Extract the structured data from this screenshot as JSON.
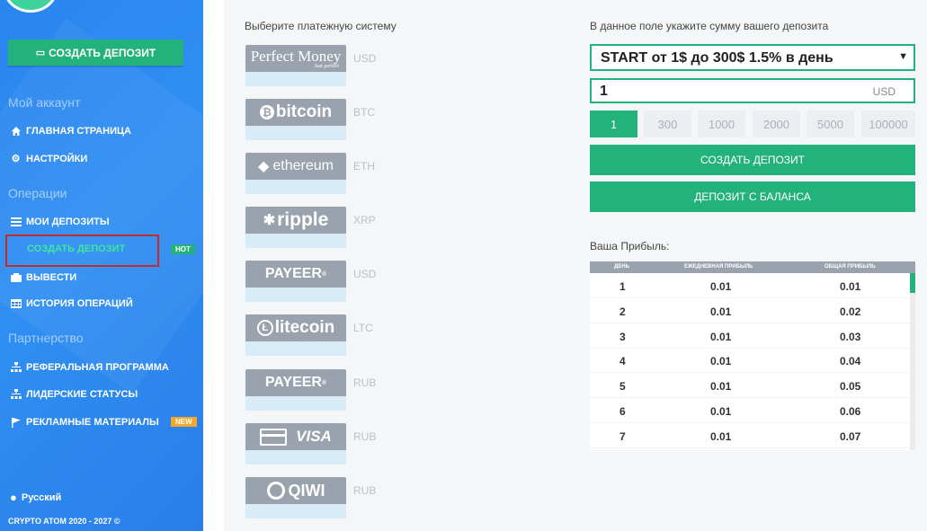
{
  "sidebar": {
    "create_button": "СОЗДАТЬ ДЕПОЗИТ",
    "sections": {
      "account": "Мой аккаунт",
      "operations": "Операции",
      "partnership": "Партнерство"
    },
    "items": {
      "home": "ГЛАВНАЯ СТРАНИЦА",
      "settings": "НАСТРОЙКИ",
      "my_deposits": "МОИ ДЕПОЗИТЫ",
      "create_deposit": "СОЗДАТЬ ДЕПОЗИТ",
      "withdraw": "ВЫВЕСТИ",
      "history": "ИСТОРИЯ ОПЕРАЦИЙ",
      "referral": "РЕФЕРАЛЬНАЯ ПРОГРАММА",
      "leader": "ЛИДЕРСКИЕ СТАТУСЫ",
      "promo": "РЕКЛАМНЫЕ МАТЕРИАЛЫ"
    },
    "badges": {
      "hot": "HOT",
      "new": "NEW"
    },
    "language": "Русский",
    "copyright": "CRYPTO ATOM 2020 - 2027 ©"
  },
  "payment": {
    "title": "Выберите платежную систему",
    "methods": [
      {
        "name": "Perfect Money",
        "sub": "Just perfect",
        "currency": "USD"
      },
      {
        "name": "bitcoin",
        "currency": "BTC"
      },
      {
        "name": "ethereum",
        "currency": "ETH"
      },
      {
        "name": "ripple",
        "currency": "XRP"
      },
      {
        "name": "PAYEER",
        "currency": "USD"
      },
      {
        "name": "litecoin",
        "currency": "LTC"
      },
      {
        "name": "PAYEER",
        "currency": "RUB"
      },
      {
        "name": "VISA",
        "currency": "RUB"
      },
      {
        "name": "QIWI",
        "currency": "RUB"
      }
    ]
  },
  "deposit": {
    "title": "В данное поле укажите сумму вашего депозита",
    "plan": "START от 1$ до 300$ 1.5% в день",
    "amount": "1",
    "currency": "USD",
    "quick_amounts": [
      "1",
      "300",
      "1000",
      "2000",
      "5000",
      "100000"
    ],
    "create_button": "СОЗДАТЬ ДЕПОЗИТ",
    "balance_button": "ДЕПОЗИТ С БАЛАНСА"
  },
  "profit": {
    "title": "Ваша Прибыль:",
    "headers": {
      "day": "ДЕНЬ",
      "daily": "ЕЖЕДНЕВНАЯ ПРИБЫЛЬ",
      "total": "ОБЩАЯ ПРИБЫЛЬ"
    },
    "rows": [
      {
        "day": "1",
        "daily": "0.01",
        "total": "0.01"
      },
      {
        "day": "2",
        "daily": "0.01",
        "total": "0.02"
      },
      {
        "day": "3",
        "daily": "0.01",
        "total": "0.03"
      },
      {
        "day": "4",
        "daily": "0.01",
        "total": "0.04"
      },
      {
        "day": "5",
        "daily": "0.01",
        "total": "0.05"
      },
      {
        "day": "6",
        "daily": "0.01",
        "total": "0.06"
      },
      {
        "day": "7",
        "daily": "0.01",
        "total": "0.07"
      }
    ]
  },
  "colors": {
    "accent": "#23b27b",
    "sidebar": "#2a86ef",
    "hot": "#23b27b",
    "new": "#f0a92a",
    "highlight": "#c62b2b"
  }
}
